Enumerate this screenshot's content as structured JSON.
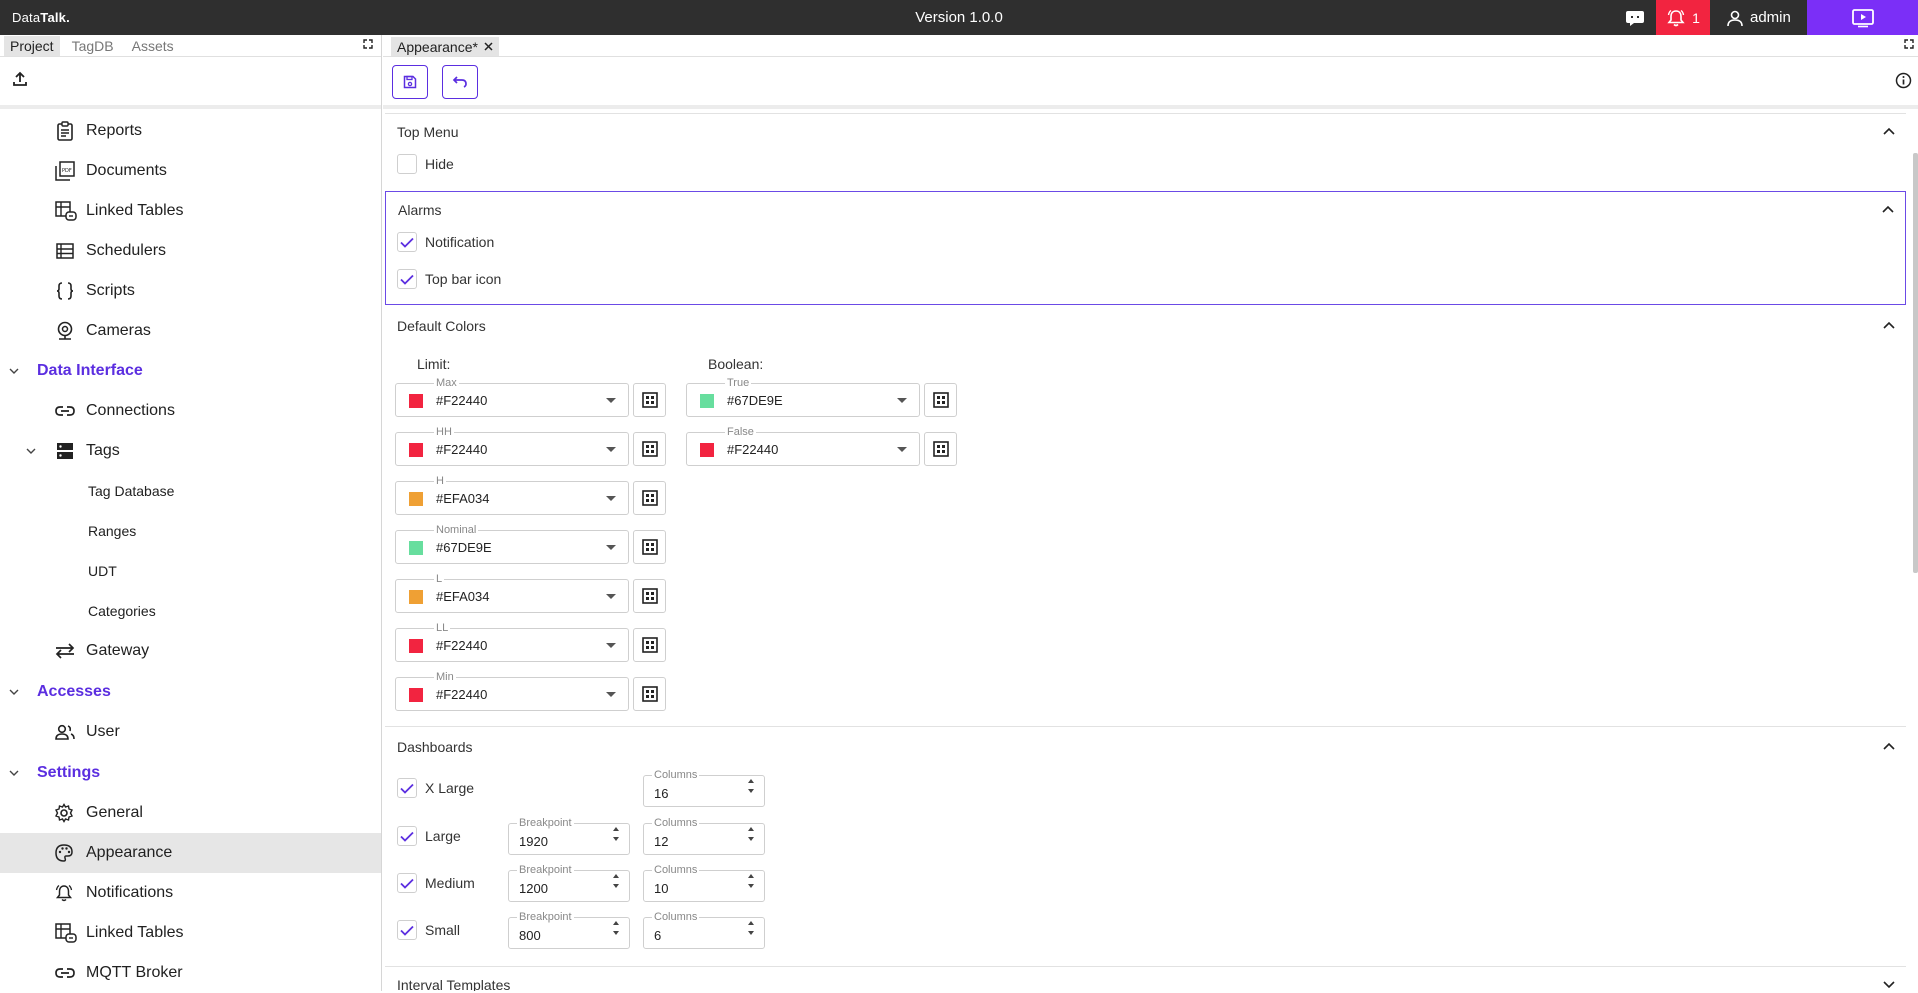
{
  "topbar": {
    "logo_light": "Data",
    "logo_bold": "Talk.",
    "version": "Version 1.0.0",
    "alarm_count": "1",
    "user": "admin",
    "alarm_color": "#F22440",
    "play_color": "#7B2FF7"
  },
  "left": {
    "tabs": [
      "Project",
      "TagDB",
      "Assets"
    ],
    "active_tab": "Project",
    "nav": [
      {
        "label": "Reports",
        "icon": "clipboard-icon"
      },
      {
        "label": "Documents",
        "icon": "pdf-icon"
      },
      {
        "label": "Linked Tables",
        "icon": "linked-table-icon"
      },
      {
        "label": "Schedulers",
        "icon": "list-icon"
      },
      {
        "label": "Scripts",
        "icon": "braces-icon"
      },
      {
        "label": "Cameras",
        "icon": "webcam-icon"
      },
      {
        "label": "Data Interface",
        "icon": "chevron-down-icon",
        "section": true
      },
      {
        "label": "Connections",
        "icon": "link-icon"
      },
      {
        "label": "Tags",
        "icon": "server-icon"
      },
      {
        "label": "Tag Database"
      },
      {
        "label": "Ranges"
      },
      {
        "label": "UDT"
      },
      {
        "label": "Categories"
      },
      {
        "label": "Gateway",
        "icon": "swap-icon"
      },
      {
        "label": "Accesses",
        "icon": "chevron-down-icon",
        "section": true
      },
      {
        "label": "User",
        "icon": "users-icon"
      },
      {
        "label": "Settings",
        "icon": "chevron-down-icon",
        "section": true
      },
      {
        "label": "General",
        "icon": "gear-icon"
      },
      {
        "label": "Appearance",
        "icon": "palette-icon",
        "selected": true
      },
      {
        "label": "Notifications",
        "icon": "bell-icon"
      },
      {
        "label": "Linked Tables",
        "icon": "linked-table-icon"
      },
      {
        "label": "MQTT Broker",
        "icon": "link-icon"
      }
    ]
  },
  "editor": {
    "tab_label": "Appearance*",
    "top_menu": {
      "title": "Top Menu",
      "hide_label": "Hide",
      "hide_checked": false
    },
    "alarms": {
      "title": "Alarms",
      "notification_label": "Notification",
      "topbar_icon_label": "Top bar icon"
    },
    "default_colors": {
      "title": "Default Colors",
      "limit_label": "Limit:",
      "boolean_label": "Boolean:",
      "limit": [
        {
          "label": "Max",
          "value": "#F22440"
        },
        {
          "label": "HH",
          "value": "#F22440"
        },
        {
          "label": "H",
          "value": "#EFA034"
        },
        {
          "label": "Nominal",
          "value": "#67DE9E"
        },
        {
          "label": "L",
          "value": "#EFA034"
        },
        {
          "label": "LL",
          "value": "#F22440"
        },
        {
          "label": "Min",
          "value": "#F22440"
        }
      ],
      "boolean": [
        {
          "label": "True",
          "value": "#67DE9E"
        },
        {
          "label": "False",
          "value": "#F22440"
        }
      ]
    },
    "dashboards": {
      "title": "Dashboards",
      "breakpoint_label": "Breakpoint",
      "columns_label": "Columns",
      "sizes": [
        {
          "label": "X Large",
          "breakpoint": null,
          "columns": "16"
        },
        {
          "label": "Large",
          "breakpoint": "1920",
          "columns": "12"
        },
        {
          "label": "Medium",
          "breakpoint": "1200",
          "columns": "10"
        },
        {
          "label": "Small",
          "breakpoint": "800",
          "columns": "6"
        }
      ]
    },
    "interval_templates": {
      "title": "Interval Templates"
    }
  },
  "colors": {
    "accent": "#5B2EE0"
  }
}
